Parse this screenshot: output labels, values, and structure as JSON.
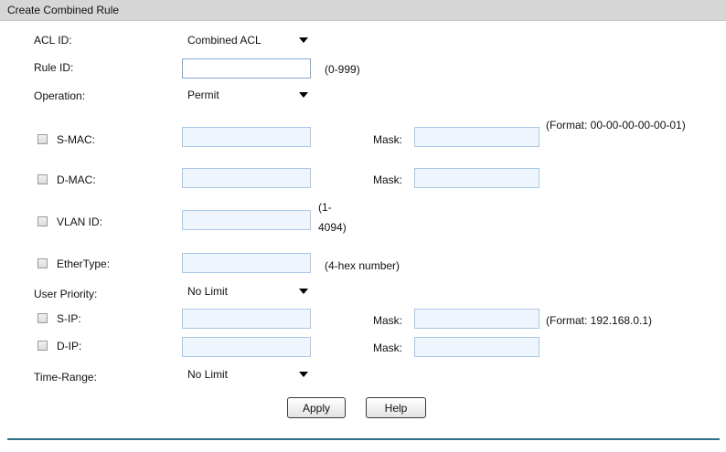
{
  "panel": {
    "title": "Create Combined Rule"
  },
  "acl_id": {
    "label": "ACL ID:",
    "value": "Combined ACL"
  },
  "rule_id": {
    "label": "Rule ID:",
    "value": "",
    "hint": "(0-999)"
  },
  "operation": {
    "label": "Operation:",
    "value": "Permit"
  },
  "s_mac": {
    "label": "S-MAC:",
    "mask_label": "Mask:",
    "hint": "(Format: 00-00-00-00-00-01)"
  },
  "d_mac": {
    "label": "D-MAC:",
    "mask_label": "Mask:"
  },
  "vlan_id": {
    "label": "VLAN ID:",
    "hint": "(1-4094)"
  },
  "ether_type": {
    "label": "EtherType:",
    "hint": "(4-hex number)"
  },
  "user_priority": {
    "label": "User Priority:",
    "value": "No Limit"
  },
  "s_ip": {
    "label": "S-IP:",
    "mask_label": "Mask:",
    "hint": "(Format: 192.168.0.1)"
  },
  "d_ip": {
    "label": "D-IP:",
    "mask_label": "Mask:"
  },
  "time_range": {
    "label": "Time-Range:",
    "value": "No Limit"
  },
  "buttons": {
    "apply": "Apply",
    "help": "Help"
  },
  "colors": {
    "header_bg": "#d6d6d6",
    "divider": "#2b7187",
    "field_border": "#a9c7e6"
  }
}
